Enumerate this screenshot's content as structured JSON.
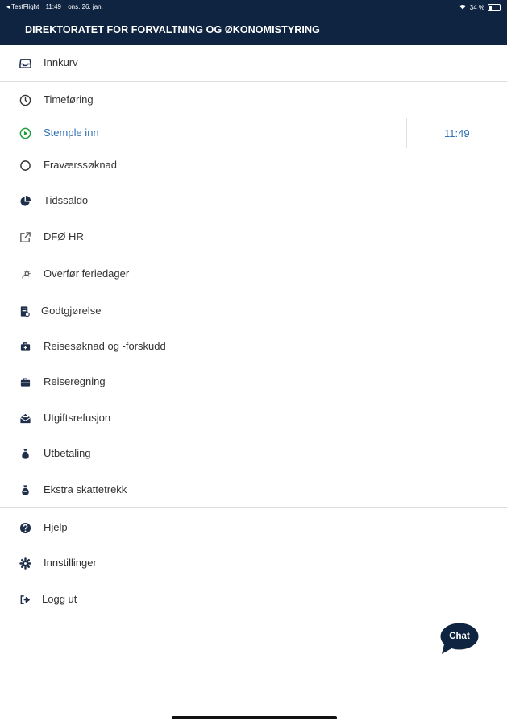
{
  "status_bar": {
    "back_app": "◂ TestFlight",
    "time": "11:49",
    "date": "ons. 26. jan.",
    "battery": "34 %"
  },
  "header": {
    "title": "DIREKTORATET FOR FORVALTNING OG ØKONOMISTYRING"
  },
  "menu": {
    "inbox": {
      "label": "Innkurv",
      "icon": "inbox-icon"
    },
    "items": [
      {
        "label": "Timeføring",
        "icon": "clock-icon"
      },
      {
        "label": "Stemple inn",
        "icon": "play-circle-icon",
        "active": true,
        "time": "11:49"
      },
      {
        "label": "Fraværssøknad",
        "icon": "circle-icon"
      },
      {
        "label": "Tidssaldo",
        "icon": "pie-chart-icon"
      },
      {
        "label": "DFØ HR",
        "icon": "external-link-icon"
      },
      {
        "label": "Overfør feriedager",
        "icon": "sun-icon"
      },
      {
        "label": "Godtgjørelse",
        "icon": "receipt-icon"
      },
      {
        "label": "Reisesøknad og -forskudd",
        "icon": "briefcase-icon"
      },
      {
        "label": "Reiseregning",
        "icon": "suitcase-icon"
      },
      {
        "label": "Utgiftsrefusjon",
        "icon": "envelope-open-icon"
      },
      {
        "label": "Utbetaling",
        "icon": "money-bag-icon"
      },
      {
        "label": "Ekstra skattetrekk",
        "icon": "money-bag-alt-icon"
      }
    ],
    "footer": [
      {
        "label": "Hjelp",
        "icon": "help-icon"
      },
      {
        "label": "Innstillinger",
        "icon": "gear-icon"
      },
      {
        "label": "Logg ut",
        "icon": "logout-icon"
      }
    ]
  },
  "chat": {
    "label": "Chat"
  },
  "colors": {
    "navy": "#0f2440",
    "active_blue": "#2f6fb3",
    "active_green": "#1e9e3c"
  }
}
